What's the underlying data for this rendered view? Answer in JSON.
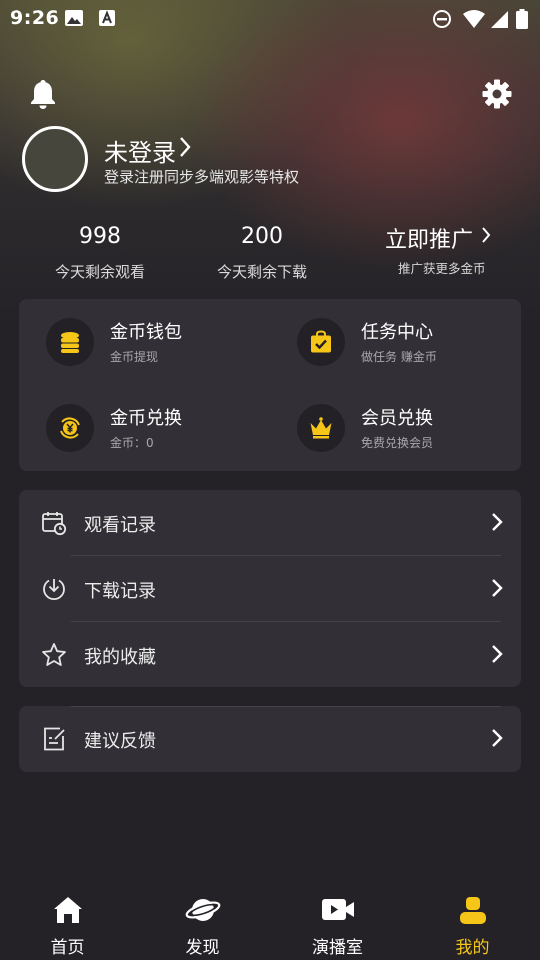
{
  "status_bar": {
    "time": "9:26"
  },
  "header": {
    "bell_icon": "bell-icon",
    "settings_icon": "gear-icon"
  },
  "profile": {
    "title": "未登录",
    "subtitle": "登录注册同步多端观影等特权"
  },
  "stats": [
    {
      "value": "998",
      "label": "今天剩余观看"
    },
    {
      "value": "200",
      "label": "今天剩余下载"
    }
  ],
  "promo": {
    "title": "立即推广",
    "subtitle": "推广获更多金币"
  },
  "features": [
    {
      "title": "金币钱包",
      "subtitle": "金币提现",
      "icon": "coin-stack-icon"
    },
    {
      "title": "任务中心",
      "subtitle": "做任务 赚金币",
      "icon": "task-bag-icon"
    },
    {
      "title": "金币兑换",
      "subtitle": "金币：0",
      "icon": "yuan-exchange-icon"
    },
    {
      "title": "会员兑换",
      "subtitle": "免费兑换会员",
      "icon": "crown-icon"
    }
  ],
  "menu": [
    {
      "label": "观看记录",
      "icon": "watch-history-icon"
    },
    {
      "label": "下载记录",
      "icon": "download-icon"
    },
    {
      "label": "我的收藏",
      "icon": "star-icon"
    }
  ],
  "feedback": {
    "label": "建议反馈",
    "icon": "feedback-icon"
  },
  "tabs": [
    {
      "label": "首页",
      "icon": "home-icon"
    },
    {
      "label": "发现",
      "icon": "planet-icon"
    },
    {
      "label": "演播室",
      "icon": "video-icon"
    },
    {
      "label": "我的",
      "icon": "profile-icon"
    }
  ],
  "colors": {
    "accent": "#f5c518",
    "background": "#242227",
    "card": "#323036"
  }
}
